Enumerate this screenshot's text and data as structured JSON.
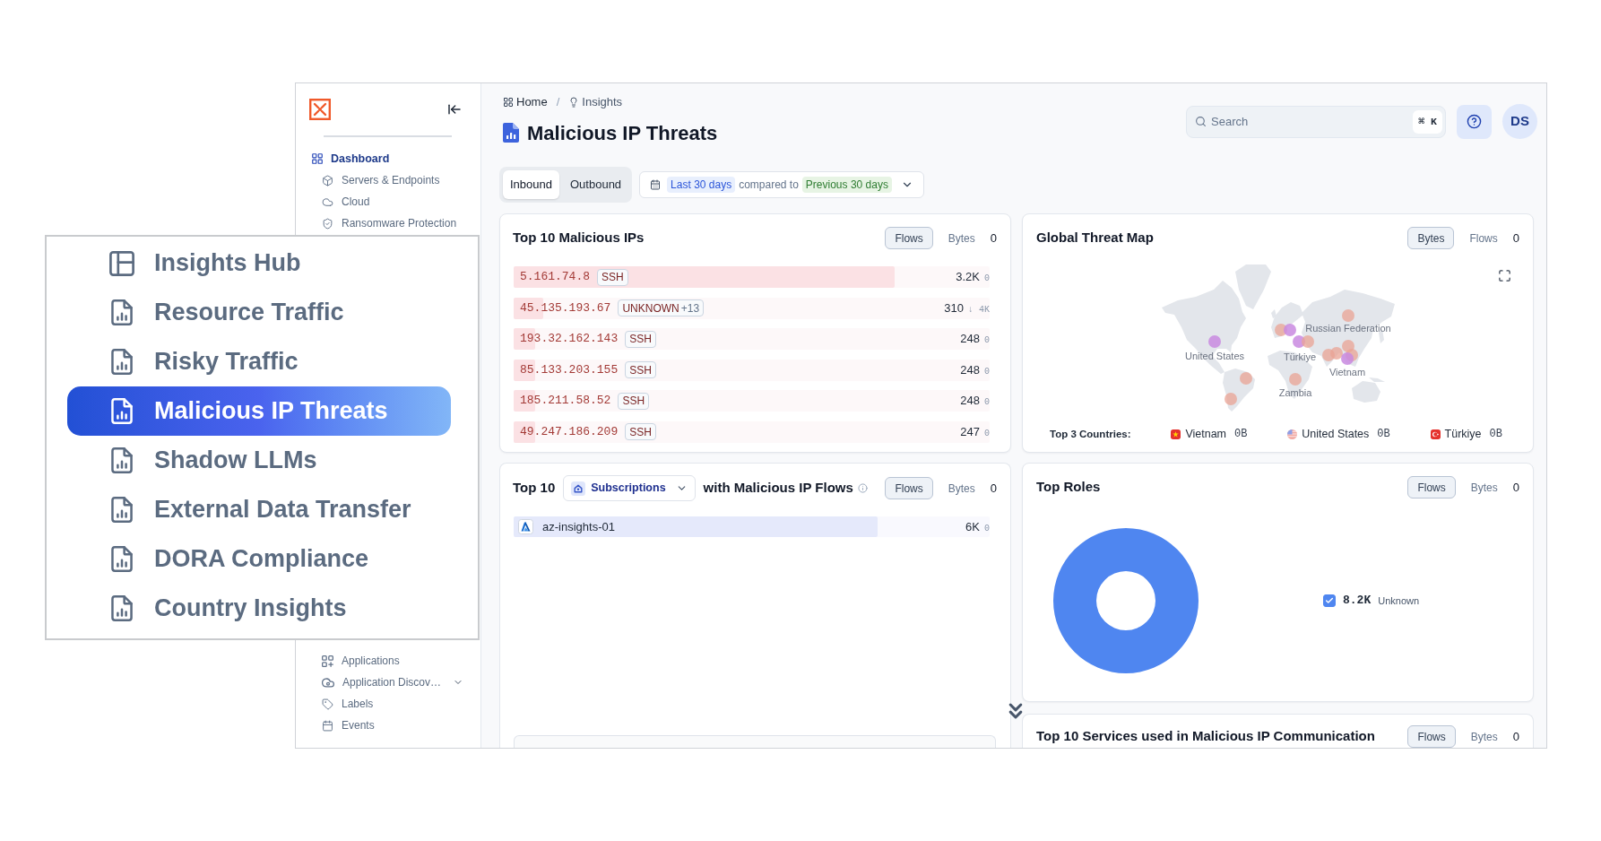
{
  "insights_menu": {
    "items": [
      {
        "label": "Insights Hub",
        "kind": "hub",
        "selected": false
      },
      {
        "label": "Resource Traffic",
        "kind": "report",
        "selected": false
      },
      {
        "label": "Risky Traffic",
        "kind": "report",
        "selected": false
      },
      {
        "label": "Malicious IP Threats",
        "kind": "report",
        "selected": true
      },
      {
        "label": "Shadow LLMs",
        "kind": "report",
        "selected": false
      },
      {
        "label": "External Data Transfer",
        "kind": "report",
        "selected": false
      },
      {
        "label": "DORA Compliance",
        "kind": "report",
        "selected": false
      },
      {
        "label": "Country Insights",
        "kind": "report",
        "selected": false
      }
    ]
  },
  "sidebar": {
    "items": [
      {
        "label": "Dashboard",
        "selected": true,
        "children": [
          {
            "label": "Servers & Endpoints",
            "selected": false
          },
          {
            "label": "Cloud",
            "selected": false
          },
          {
            "label": "Ransomware Protection",
            "selected": false
          }
        ]
      }
    ],
    "lower_items": [
      {
        "label": "Applications",
        "kind": "link",
        "selected": false
      },
      {
        "label": "Application Discov…",
        "kind": "group",
        "selected": false
      },
      {
        "label": "Labels",
        "kind": "link",
        "selected": false
      },
      {
        "label": "Events",
        "kind": "link",
        "selected": false
      }
    ]
  },
  "breadcrumb": {
    "items": [
      {
        "label": "Home"
      },
      {
        "label": "Insights"
      }
    ],
    "separator": "/"
  },
  "page_title": "Malicious IP Threats",
  "search": {
    "placeholder": "Search",
    "shortcut": "⌘ K"
  },
  "avatar": {
    "initials": "DS"
  },
  "direction_tabs": [
    {
      "label": "Inbound",
      "selected": true
    },
    {
      "label": "Outbound",
      "selected": false
    }
  ],
  "date_filter": {
    "range": "Last 30 days",
    "connector": "compared to",
    "comparison": "Previous 30 days"
  },
  "top_malicious_ips": {
    "title": "Top 10 Malicious IPs",
    "metric_tabs": [
      {
        "label": "Flows",
        "selected": true
      },
      {
        "label": "Bytes",
        "selected": false
      }
    ],
    "metric_extra": "0",
    "rows": [
      {
        "ip": "5.161.74.8",
        "tag": "SSH",
        "value": "3.2K",
        "change": "0",
        "level": 0.8
      },
      {
        "ip": "45.135.193.67",
        "tag": "UNKNOWN",
        "tag_more": "+13",
        "value": "310",
        "change": "↓ 4K",
        "level": 0.062
      },
      {
        "ip": "193.32.162.143",
        "tag": "SSH",
        "value": "248",
        "change": "0",
        "level": 0.045
      },
      {
        "ip": "85.133.203.155",
        "tag": "SSH",
        "value": "248",
        "change": "0",
        "level": 0.045
      },
      {
        "ip": "185.211.58.52",
        "tag": "SSH",
        "value": "248",
        "change": "0",
        "level": 0.045
      },
      {
        "ip": "49.247.186.209",
        "tag": "SSH",
        "value": "247",
        "change": "0",
        "level": 0.045
      }
    ]
  },
  "global_threat_map": {
    "title": "Global Threat Map",
    "metric_tabs": [
      {
        "label": "Bytes",
        "selected": true
      },
      {
        "label": "Flows",
        "selected": false
      }
    ],
    "metric_extra": "0",
    "map_labels": [
      "United States",
      "Russian Federation",
      "Türkiye",
      "Vietnam",
      "Zambia"
    ],
    "top_countries_label": "Top 3 Countries:",
    "top_countries": [
      {
        "name": "Vietnam",
        "value": "0B"
      },
      {
        "name": "United States",
        "value": "0B"
      },
      {
        "name": "Türkiye",
        "value": "0B"
      }
    ]
  },
  "top_subscriptions": {
    "title_start": "Top 10",
    "group_by": "Subscriptions",
    "title_end": "with Malicious IP Flows",
    "metric_tabs": [
      {
        "label": "Flows",
        "selected": true
      },
      {
        "label": "Bytes",
        "selected": false
      }
    ],
    "metric_extra": "0",
    "rows": [
      {
        "name": "az-insights-01",
        "value": "6K",
        "change": "0",
        "level": 0.765
      }
    ]
  },
  "top_roles": {
    "title": "Top Roles",
    "metric_tabs": [
      {
        "label": "Flows",
        "selected": true
      },
      {
        "label": "Bytes",
        "selected": false
      }
    ],
    "metric_extra": "0",
    "legend": [
      {
        "value": "8.2K",
        "label": "Unknown",
        "checked": true,
        "color": "#4f86f0"
      }
    ]
  },
  "top_services": {
    "title": "Top 10 Services used in Malicious IP Communication",
    "metric_tabs": [
      {
        "label": "Flows",
        "selected": true
      },
      {
        "label": "Bytes",
        "selected": false
      }
    ],
    "metric_extra": "0"
  }
}
